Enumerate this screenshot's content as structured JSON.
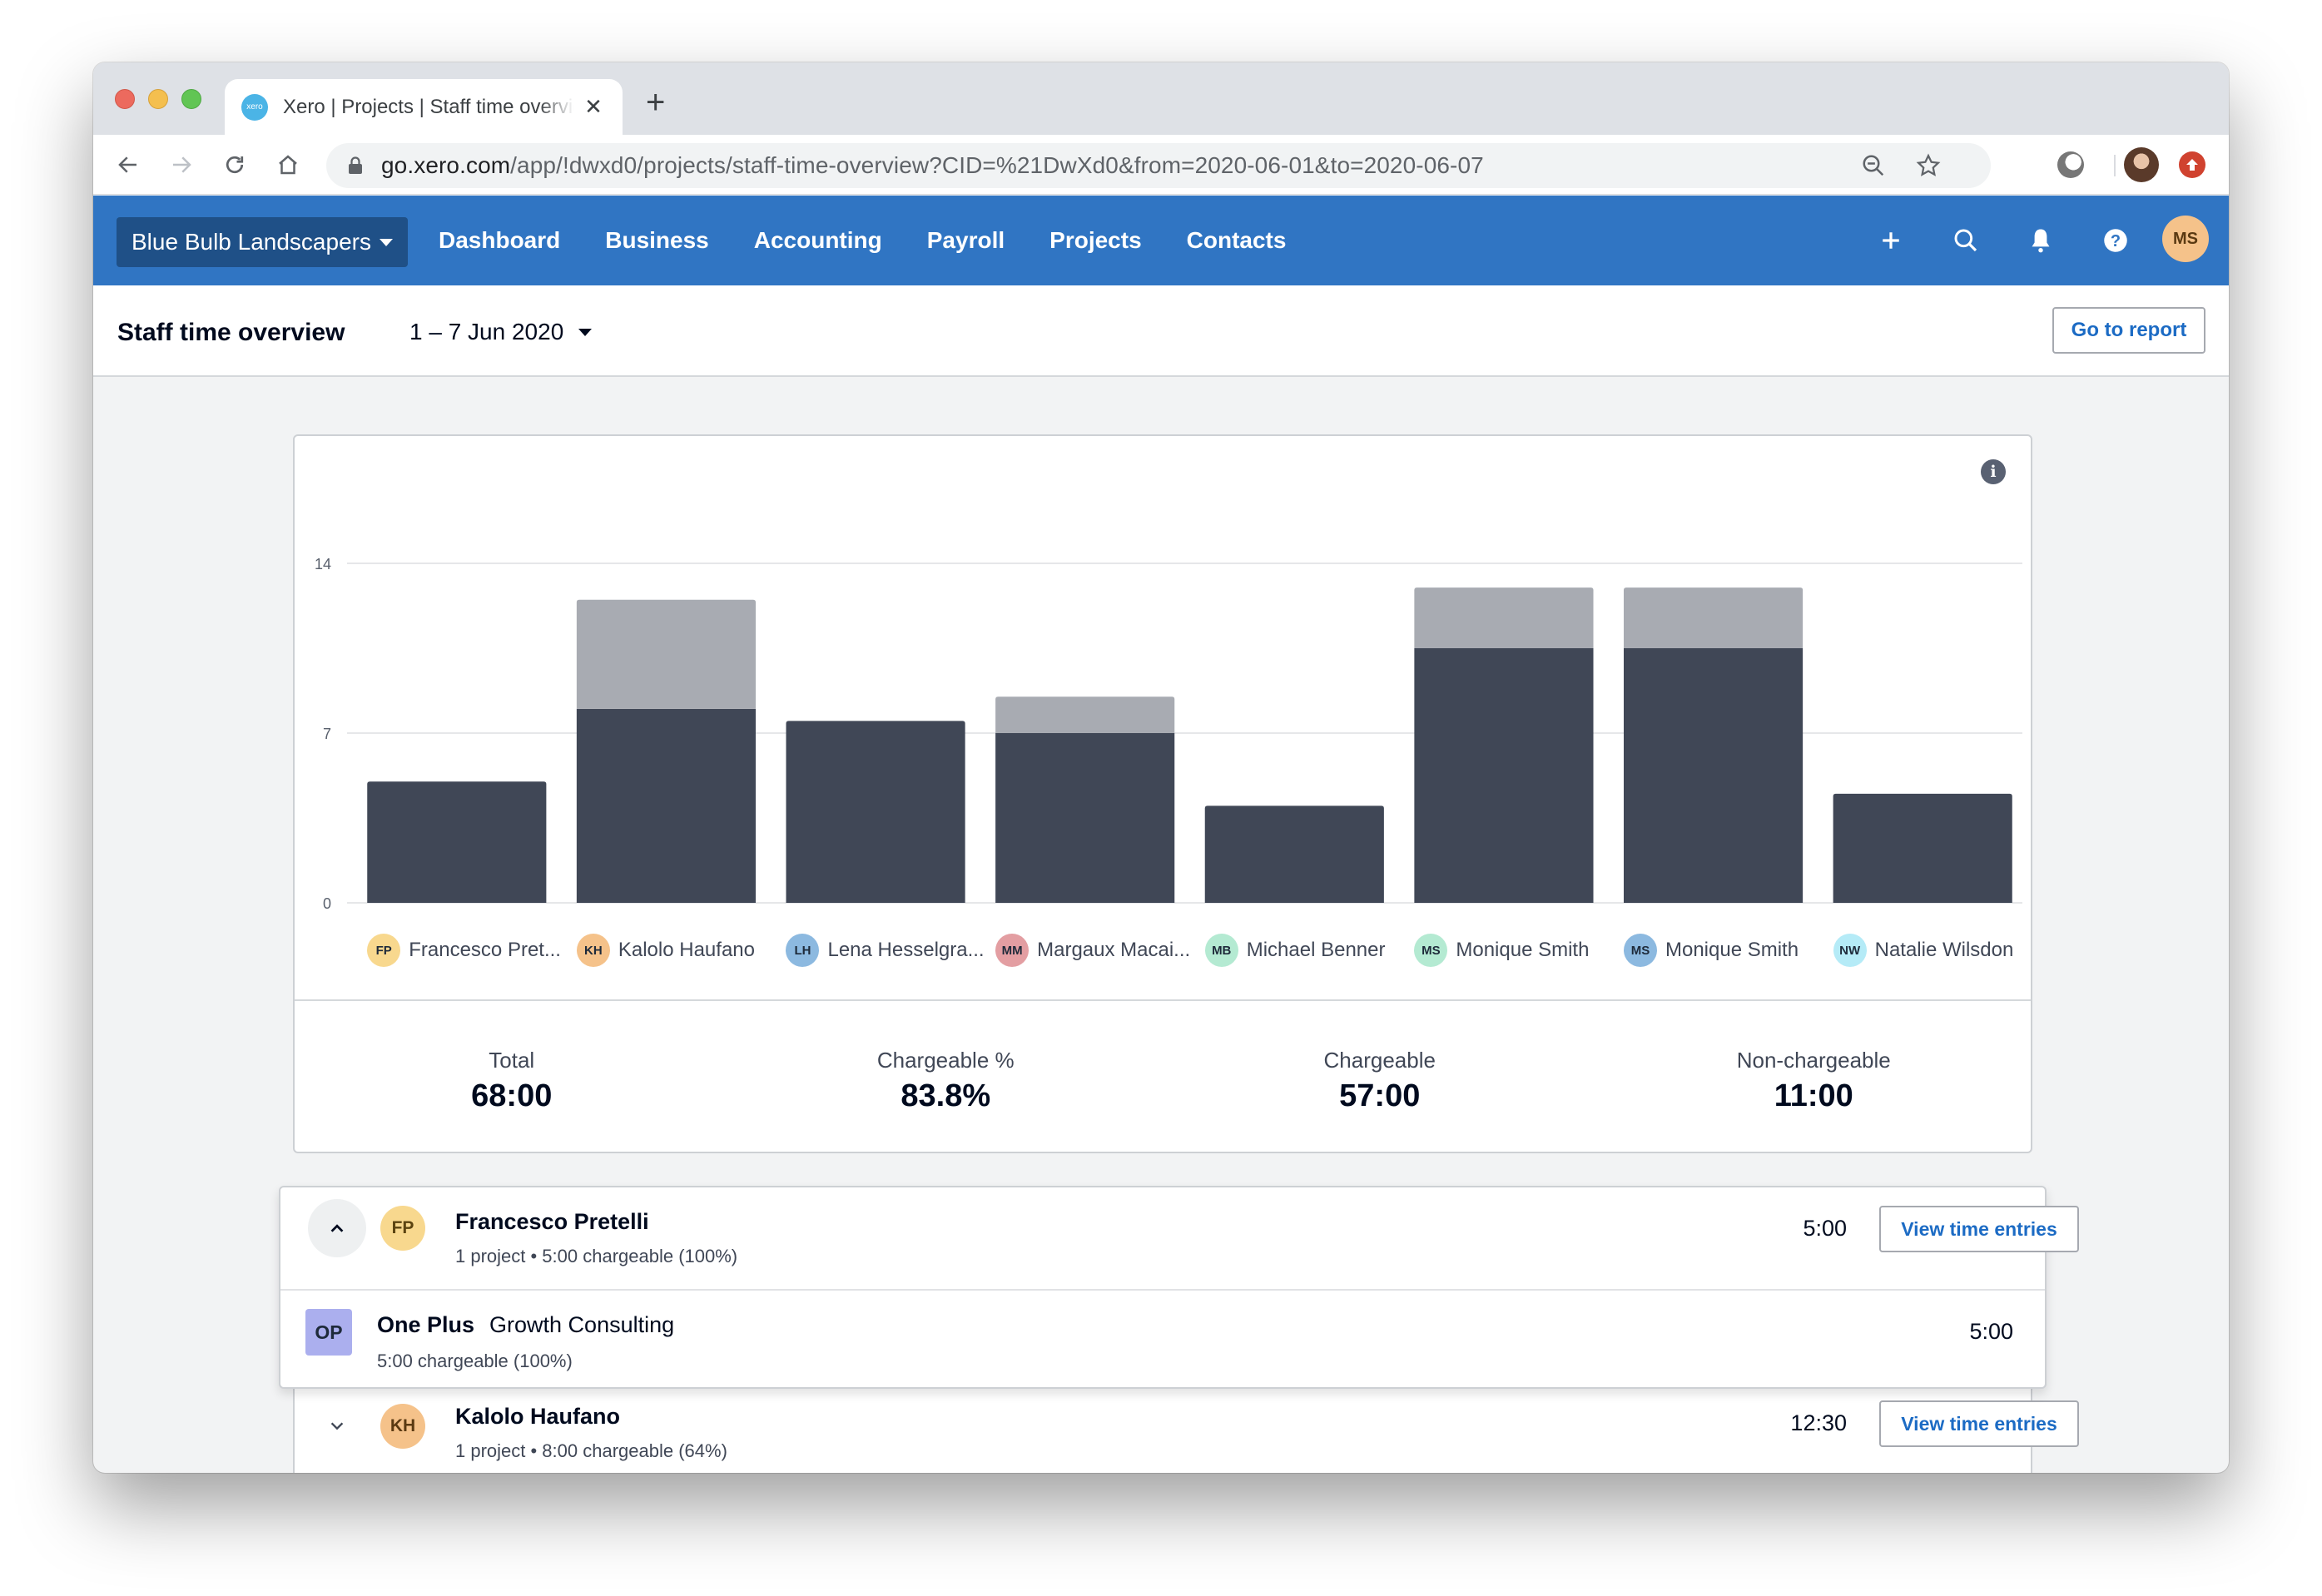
{
  "browser": {
    "tab_title": "Xero | Projects | Staff time overview",
    "favicon_text": "xero",
    "url_host": "go.xero.com",
    "url_path": "/app/!dwxd0/projects/staff-time-overview?CID=%21DwXd0&from=2020-06-01&to=2020-06-07"
  },
  "nav": {
    "org_name": "Blue Bulb Landscapers",
    "links": [
      "Dashboard",
      "Business",
      "Accounting",
      "Payroll",
      "Projects",
      "Contacts"
    ],
    "user_initials": "MS",
    "colors": {
      "bar": "#3075C3",
      "org_switcher": "#1F5087"
    }
  },
  "header": {
    "title": "Staff time overview",
    "date_range": "1 – 7 Jun 2020",
    "report_button": "Go to report"
  },
  "chart_data": {
    "type": "bar",
    "stacked": true,
    "title": "",
    "xlabel": "",
    "ylabel": "",
    "ylim": [
      0,
      14
    ],
    "yticks": [
      0,
      7,
      14
    ],
    "grid": true,
    "categories": [
      "Francesco Pretelli",
      "Kalolo Haufano",
      "Lena Hesselgren",
      "Margaux Macaire",
      "Michael Benner",
      "Monique Smith",
      "Monique Smith",
      "Natalie Wilsdon"
    ],
    "series": [
      {
        "name": "Chargeable",
        "color": "#404756",
        "values": [
          5,
          8,
          7.5,
          7,
          4,
          10.5,
          10.5,
          4.5
        ]
      },
      {
        "name": "Non-chargeable",
        "color": "#A8ABB2",
        "values": [
          0,
          4.5,
          0,
          1.5,
          0,
          2.5,
          2.5,
          0
        ]
      }
    ]
  },
  "legend": [
    {
      "initials": "FP",
      "label": "Francesco Pret...",
      "color": "#F8D88E"
    },
    {
      "initials": "KH",
      "label": "Kalolo Haufano",
      "color": "#F5C28A"
    },
    {
      "initials": "LH",
      "label": "Lena Hesselgra...",
      "color": "#8CB9E0"
    },
    {
      "initials": "MM",
      "label": "Margaux Macai...",
      "color": "#E39EA2"
    },
    {
      "initials": "MB",
      "label": "Michael Benner",
      "color": "#B4EAD2"
    },
    {
      "initials": "MS",
      "label": "Monique Smith",
      "color": "#B4EAD2"
    },
    {
      "initials": "MS",
      "label": "Monique Smith",
      "color": "#8CB9E0"
    },
    {
      "initials": "NW",
      "label": "Natalie Wilsdon",
      "color": "#B5EBF7"
    }
  ],
  "stats": [
    {
      "label": "Total",
      "value": "68:00"
    },
    {
      "label": "Chargeable %",
      "value": "83.8%"
    },
    {
      "label": "Chargeable",
      "value": "57:00"
    },
    {
      "label": "Non-chargeable",
      "value": "11:00"
    }
  ],
  "staff": [
    {
      "initials": "FP",
      "name": "Francesco Pretelli",
      "color": "#F8D88E",
      "meta": "1 project • 5:00 chargeable (100%)",
      "time": "5:00",
      "expanded": true,
      "button": "View time entries",
      "projects": [
        {
          "badge": "OP",
          "client": "One Plus",
          "name": "Growth Consulting",
          "meta": "5:00 chargeable (100%)",
          "time": "5:00"
        }
      ]
    },
    {
      "initials": "KH",
      "name": "Kalolo Haufano",
      "color": "#F5C28A",
      "meta": "1 project • 8:00 chargeable (64%)",
      "time": "12:30",
      "expanded": false,
      "button": "View time entries"
    }
  ]
}
